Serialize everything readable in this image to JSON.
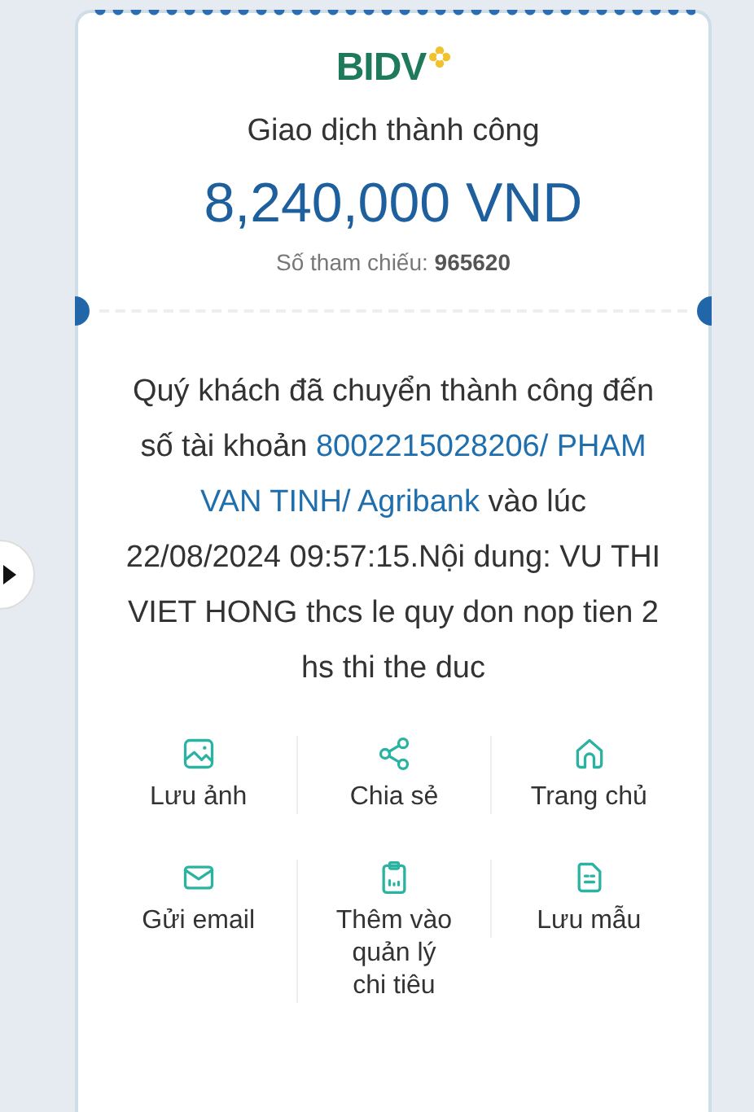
{
  "receipt": {
    "logo": "BIDV",
    "status": "Giao dịch thành công",
    "amount": "8,240,000 VND",
    "reference_label": "Số tham chiếu:",
    "reference": "965620",
    "message": [
      {
        "kind": "plain",
        "text": "Quý khách đã chuyển thành công đến số tài khoản "
      },
      {
        "kind": "highlight",
        "text": "8002215028206/ PHAM VAN TINH/ Agribank"
      },
      {
        "kind": "plain",
        "text": " vào lúc 22/08/2024 09:57:15.Nội dung: VU THI VIET HONG thcs le quy don nop tien 2 hs thi the duc"
      }
    ]
  },
  "actions": [
    {
      "kind": "image",
      "label": "Lưu ảnh"
    },
    {
      "kind": "share",
      "label": "Chia sẻ"
    },
    {
      "kind": "home",
      "label": "Trang chủ"
    },
    {
      "kind": "email",
      "label": "Gửi email"
    },
    {
      "kind": "clipboard",
      "label": "Thêm vào quản lý chi tiêu"
    },
    {
      "kind": "document",
      "label": "Lưu mẫu"
    }
  ]
}
